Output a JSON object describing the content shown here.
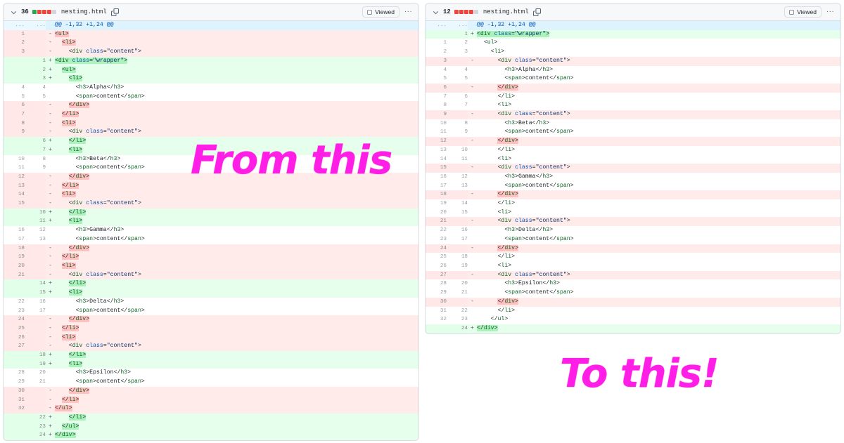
{
  "annotations": {
    "from_label": "From this",
    "to_label": "To this!",
    "color": "#ff1ee6"
  },
  "colors": {
    "addition_bg": "#e6ffec",
    "addition_gutter": "#ccffd8",
    "addition_word": "#abf2bc",
    "deletion_bg": "#ffebe9",
    "deletion_gutter": "#ffd7d5",
    "deletion_word": "#ffb0ae",
    "hunk_bg": "#ddf4ff",
    "hunk_text": "#0550ae",
    "header_bg": "#f6f8fa",
    "border": "#d8dee4",
    "stat_add": "#2da44e",
    "stat_del": "#f0453c",
    "stat_neutral": "#d0d7de",
    "tag": "#116329",
    "attr": "#0550ae",
    "string": "#0a3069"
  },
  "panels": [
    {
      "id": "left-panel",
      "header": {
        "chevron": "chevron-down-icon",
        "changes_count": "36",
        "stat_blocks": [
          "add",
          "del",
          "del",
          "del",
          "neutral"
        ],
        "file_name": "nesting.html",
        "copy_icon": "copy-path-icon",
        "viewed_label": "Viewed",
        "viewed_checked": false,
        "kebab_label": "···"
      },
      "hunk_header": "@@ -1,32 +1,24 @@",
      "rows": [
        {
          "type": "hunk",
          "old": "...",
          "new": "...",
          "marker": "",
          "code": "@@ -1,32 +1,24 @@"
        },
        {
          "type": "del",
          "old": "1",
          "new": "",
          "marker": "-",
          "code": "<ul>"
        },
        {
          "type": "del",
          "old": "2",
          "new": "",
          "marker": "-",
          "code": "  <li>"
        },
        {
          "type": "del",
          "old": "3",
          "new": "",
          "marker": "-",
          "code": "    <div class=\"content\">"
        },
        {
          "type": "add",
          "old": "",
          "new": "1",
          "marker": "+",
          "code": "<div class=\"wrapper\">"
        },
        {
          "type": "add",
          "old": "",
          "new": "2",
          "marker": "+",
          "code": "  <ul>"
        },
        {
          "type": "add",
          "old": "",
          "new": "3",
          "marker": "+",
          "code": "    <li>"
        },
        {
          "type": "ctx",
          "old": "4",
          "new": "4",
          "marker": "",
          "code": "      <h3>Alpha</h3>"
        },
        {
          "type": "ctx",
          "old": "5",
          "new": "5",
          "marker": "",
          "code": "      <span>content</span>"
        },
        {
          "type": "del",
          "old": "6",
          "new": "",
          "marker": "-",
          "code": "    </div>"
        },
        {
          "type": "del",
          "old": "7",
          "new": "",
          "marker": "-",
          "code": "  </li>"
        },
        {
          "type": "del",
          "old": "8",
          "new": "",
          "marker": "-",
          "code": "  <li>"
        },
        {
          "type": "del",
          "old": "9",
          "new": "",
          "marker": "-",
          "code": "    <div class=\"content\">"
        },
        {
          "type": "add",
          "old": "",
          "new": "6",
          "marker": "+",
          "code": "    </li>"
        },
        {
          "type": "add",
          "old": "",
          "new": "7",
          "marker": "+",
          "code": "    <li>"
        },
        {
          "type": "ctx",
          "old": "10",
          "new": "8",
          "marker": "",
          "code": "      <h3>Beta</h3>"
        },
        {
          "type": "ctx",
          "old": "11",
          "new": "9",
          "marker": "",
          "code": "      <span>content</span>"
        },
        {
          "type": "del",
          "old": "12",
          "new": "",
          "marker": "-",
          "code": "    </div>"
        },
        {
          "type": "del",
          "old": "13",
          "new": "",
          "marker": "-",
          "code": "  </li>"
        },
        {
          "type": "del",
          "old": "14",
          "new": "",
          "marker": "-",
          "code": "  <li>"
        },
        {
          "type": "del",
          "old": "15",
          "new": "",
          "marker": "-",
          "code": "    <div class=\"content\">"
        },
        {
          "type": "add",
          "old": "",
          "new": "10",
          "marker": "+",
          "code": "    </li>"
        },
        {
          "type": "add",
          "old": "",
          "new": "11",
          "marker": "+",
          "code": "    <li>"
        },
        {
          "type": "ctx",
          "old": "16",
          "new": "12",
          "marker": "",
          "code": "      <h3>Gamma</h3>"
        },
        {
          "type": "ctx",
          "old": "17",
          "new": "13",
          "marker": "",
          "code": "      <span>content</span>"
        },
        {
          "type": "del",
          "old": "18",
          "new": "",
          "marker": "-",
          "code": "    </div>"
        },
        {
          "type": "del",
          "old": "19",
          "new": "",
          "marker": "-",
          "code": "  </li>"
        },
        {
          "type": "del",
          "old": "20",
          "new": "",
          "marker": "-",
          "code": "  <li>"
        },
        {
          "type": "del",
          "old": "21",
          "new": "",
          "marker": "-",
          "code": "    <div class=\"content\">"
        },
        {
          "type": "add",
          "old": "",
          "new": "14",
          "marker": "+",
          "code": "    </li>"
        },
        {
          "type": "add",
          "old": "",
          "new": "15",
          "marker": "+",
          "code": "    <li>"
        },
        {
          "type": "ctx",
          "old": "22",
          "new": "16",
          "marker": "",
          "code": "      <h3>Delta</h3>"
        },
        {
          "type": "ctx",
          "old": "23",
          "new": "17",
          "marker": "",
          "code": "      <span>content</span>"
        },
        {
          "type": "del",
          "old": "24",
          "new": "",
          "marker": "-",
          "code": "    </div>"
        },
        {
          "type": "del",
          "old": "25",
          "new": "",
          "marker": "-",
          "code": "  </li>"
        },
        {
          "type": "del",
          "old": "26",
          "new": "",
          "marker": "-",
          "code": "  <li>"
        },
        {
          "type": "del",
          "old": "27",
          "new": "",
          "marker": "-",
          "code": "    <div class=\"content\">"
        },
        {
          "type": "add",
          "old": "",
          "new": "18",
          "marker": "+",
          "code": "    </li>"
        },
        {
          "type": "add",
          "old": "",
          "new": "19",
          "marker": "+",
          "code": "    <li>"
        },
        {
          "type": "ctx",
          "old": "28",
          "new": "20",
          "marker": "",
          "code": "      <h3>Epsilon</h3>"
        },
        {
          "type": "ctx",
          "old": "29",
          "new": "21",
          "marker": "",
          "code": "      <span>content</span>"
        },
        {
          "type": "del",
          "old": "30",
          "new": "",
          "marker": "-",
          "code": "    </div>"
        },
        {
          "type": "del",
          "old": "31",
          "new": "",
          "marker": "-",
          "code": "  </li>"
        },
        {
          "type": "del",
          "old": "32",
          "new": "",
          "marker": "-",
          "code": "</ul>"
        },
        {
          "type": "add",
          "old": "",
          "new": "22",
          "marker": "+",
          "code": "    </li>"
        },
        {
          "type": "add",
          "old": "",
          "new": "23",
          "marker": "+",
          "code": "  </ul>"
        },
        {
          "type": "add",
          "old": "",
          "new": "24",
          "marker": "+",
          "code": "</div>"
        }
      ]
    },
    {
      "id": "right-panel",
      "header": {
        "chevron": "chevron-down-icon",
        "changes_count": "12",
        "stat_blocks": [
          "del",
          "del",
          "del",
          "del",
          "neutral"
        ],
        "file_name": "nesting.html",
        "copy_icon": "copy-path-icon",
        "viewed_label": "Viewed",
        "viewed_checked": false,
        "kebab_label": "···"
      },
      "hunk_header": "@@ -1,32 +1,24 @@",
      "rows": [
        {
          "type": "hunk",
          "old": "...",
          "new": "...",
          "marker": "",
          "code": "@@ -1,32 +1,24 @@"
        },
        {
          "type": "add",
          "old": "",
          "new": "1",
          "marker": "+",
          "code": "<div class=\"wrapper\">"
        },
        {
          "type": "ctx",
          "old": "1",
          "new": "2",
          "marker": "",
          "code": "  <ul>"
        },
        {
          "type": "ctx",
          "old": "2",
          "new": "3",
          "marker": "",
          "code": "    <li>"
        },
        {
          "type": "del",
          "old": "3",
          "new": "",
          "marker": "-",
          "code": "      <div class=\"content\">"
        },
        {
          "type": "ctx",
          "old": "4",
          "new": "4",
          "marker": "",
          "code": "        <h3>Alpha</h3>"
        },
        {
          "type": "ctx",
          "old": "5",
          "new": "5",
          "marker": "",
          "code": "        <span>content</span>"
        },
        {
          "type": "del",
          "old": "6",
          "new": "",
          "marker": "-",
          "code": "      </div>"
        },
        {
          "type": "ctx",
          "old": "7",
          "new": "6",
          "marker": "",
          "code": "      </li>"
        },
        {
          "type": "ctx",
          "old": "8",
          "new": "7",
          "marker": "",
          "code": "      <li>"
        },
        {
          "type": "del",
          "old": "9",
          "new": "",
          "marker": "-",
          "code": "      <div class=\"content\">"
        },
        {
          "type": "ctx",
          "old": "10",
          "new": "8",
          "marker": "",
          "code": "        <h3>Beta</h3>"
        },
        {
          "type": "ctx",
          "old": "11",
          "new": "9",
          "marker": "",
          "code": "        <span>content</span>"
        },
        {
          "type": "del",
          "old": "12",
          "new": "",
          "marker": "-",
          "code": "      </div>"
        },
        {
          "type": "ctx",
          "old": "13",
          "new": "10",
          "marker": "",
          "code": "      </li>"
        },
        {
          "type": "ctx",
          "old": "14",
          "new": "11",
          "marker": "",
          "code": "      <li>"
        },
        {
          "type": "del",
          "old": "15",
          "new": "",
          "marker": "-",
          "code": "      <div class=\"content\">"
        },
        {
          "type": "ctx",
          "old": "16",
          "new": "12",
          "marker": "",
          "code": "        <h3>Gamma</h3>"
        },
        {
          "type": "ctx",
          "old": "17",
          "new": "13",
          "marker": "",
          "code": "        <span>content</span>"
        },
        {
          "type": "del",
          "old": "18",
          "new": "",
          "marker": "-",
          "code": "      </div>"
        },
        {
          "type": "ctx",
          "old": "19",
          "new": "14",
          "marker": "",
          "code": "      </li>"
        },
        {
          "type": "ctx",
          "old": "20",
          "new": "15",
          "marker": "",
          "code": "      <li>"
        },
        {
          "type": "del",
          "old": "21",
          "new": "",
          "marker": "-",
          "code": "      <div class=\"content\">"
        },
        {
          "type": "ctx",
          "old": "22",
          "new": "16",
          "marker": "",
          "code": "        <h3>Delta</h3>"
        },
        {
          "type": "ctx",
          "old": "23",
          "new": "17",
          "marker": "",
          "code": "        <span>content</span>"
        },
        {
          "type": "del",
          "old": "24",
          "new": "",
          "marker": "-",
          "code": "      </div>"
        },
        {
          "type": "ctx",
          "old": "25",
          "new": "18",
          "marker": "",
          "code": "      </li>"
        },
        {
          "type": "ctx",
          "old": "26",
          "new": "19",
          "marker": "",
          "code": "      <li>"
        },
        {
          "type": "del",
          "old": "27",
          "new": "",
          "marker": "-",
          "code": "      <div class=\"content\">"
        },
        {
          "type": "ctx",
          "old": "28",
          "new": "20",
          "marker": "",
          "code": "        <h3>Epsilon</h3>"
        },
        {
          "type": "ctx",
          "old": "29",
          "new": "21",
          "marker": "",
          "code": "        <span>content</span>"
        },
        {
          "type": "del",
          "old": "30",
          "new": "",
          "marker": "-",
          "code": "      </div>"
        },
        {
          "type": "ctx",
          "old": "31",
          "new": "22",
          "marker": "",
          "code": "      </li>"
        },
        {
          "type": "ctx",
          "old": "32",
          "new": "23",
          "marker": "",
          "code": "    </ul>"
        },
        {
          "type": "add",
          "old": "",
          "new": "24",
          "marker": "+",
          "code": "</div>"
        }
      ]
    }
  ]
}
